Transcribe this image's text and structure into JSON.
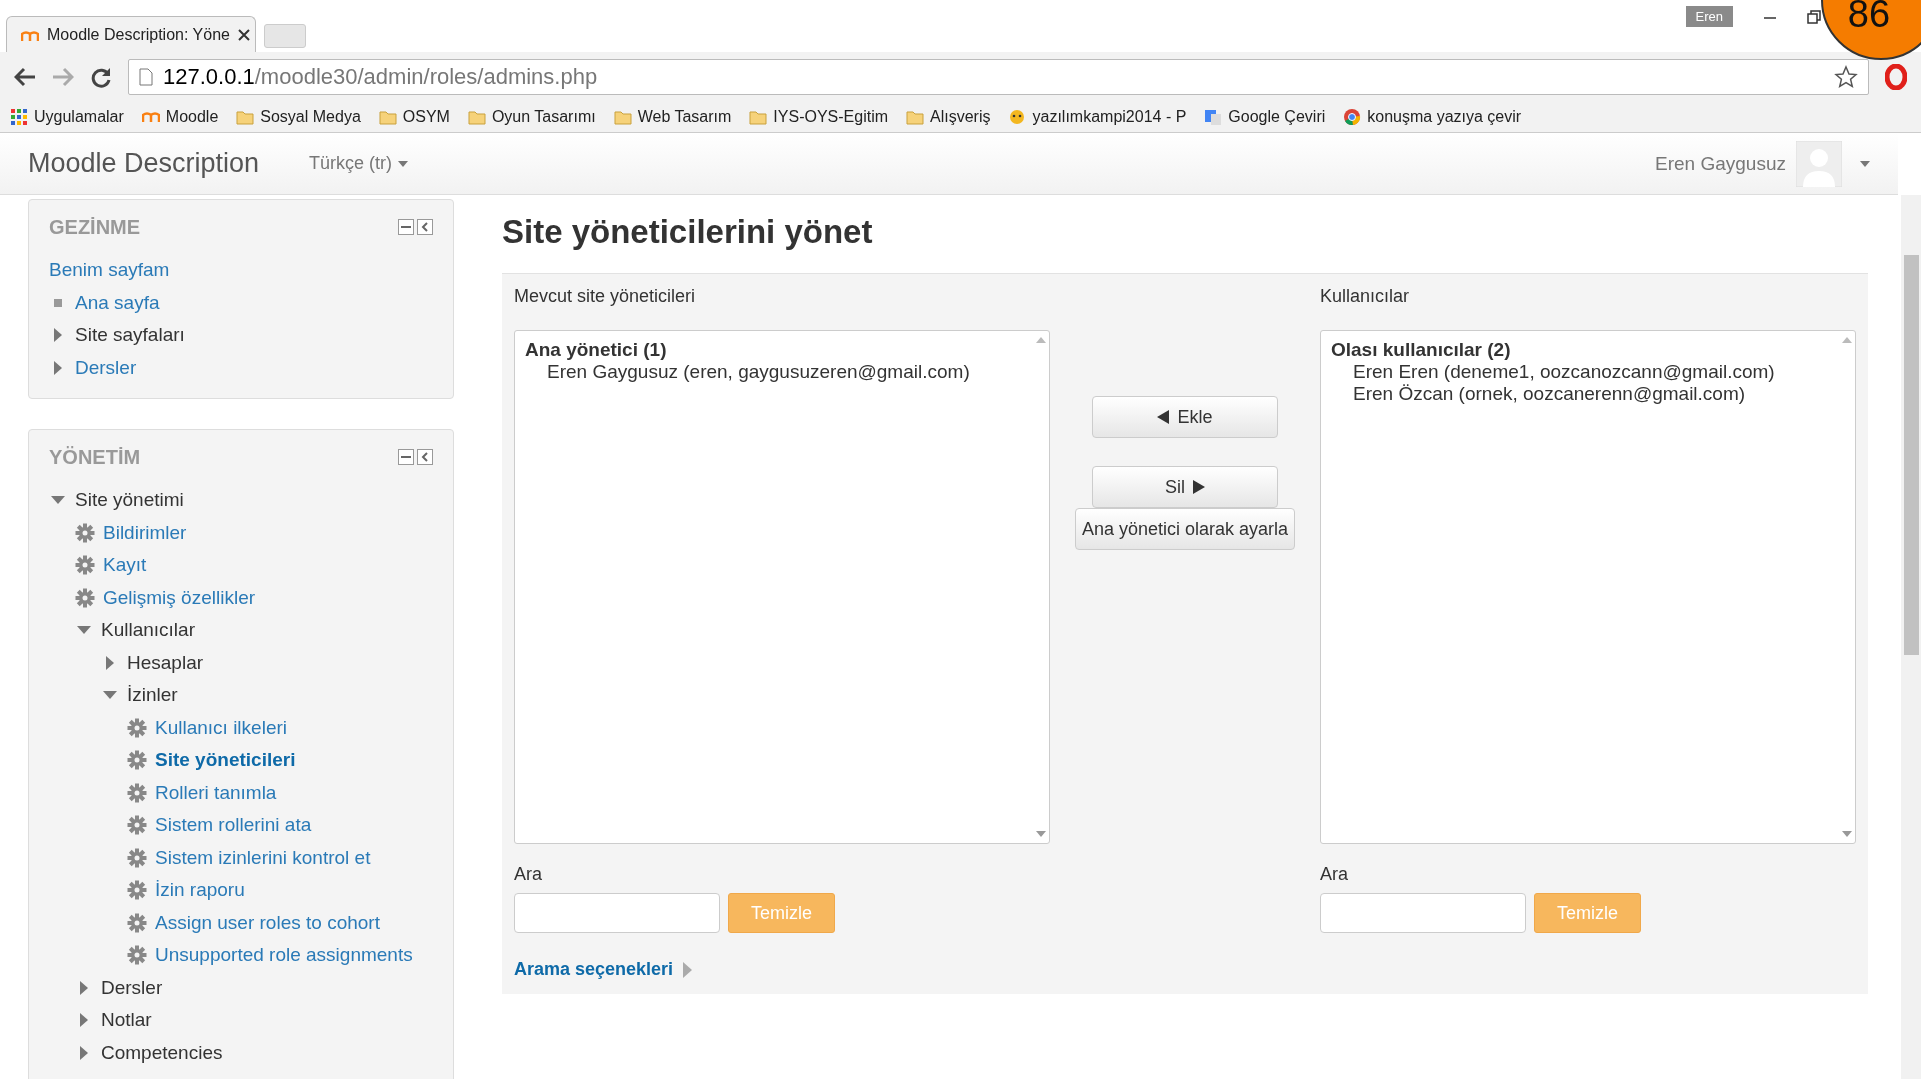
{
  "browser": {
    "tab_title": "Moodle Description: Yöne",
    "profile": "Eren",
    "url_host": "127.0.0.1",
    "url_path": "/moodle30/admin/roles/admins.php",
    "bookmarks": [
      {
        "label": "Uygulamalar",
        "kind": "apps"
      },
      {
        "label": "Moodle",
        "kind": "moodle"
      },
      {
        "label": "Sosyal Medya",
        "kind": "folder"
      },
      {
        "label": "OSYM",
        "kind": "folder"
      },
      {
        "label": "Oyun Tasarımı",
        "kind": "folder"
      },
      {
        "label": "Web Tasarım",
        "kind": "folder"
      },
      {
        "label": "IYS-OYS-Egitim",
        "kind": "folder"
      },
      {
        "label": "Alışveriş",
        "kind": "folder"
      },
      {
        "label": "yazılımkampi2014 - P",
        "kind": "cat"
      },
      {
        "label": "Google Çeviri",
        "kind": "translate"
      },
      {
        "label": "konuşma yazıya çevir",
        "kind": "chrome"
      }
    ]
  },
  "page_badge": "86",
  "navbar": {
    "brand": "Moodle Description",
    "language": "Türkçe (tr)",
    "user": "Eren Gaygusuz"
  },
  "blocks": [
    {
      "title": "GEZİNME",
      "items": [
        {
          "label": "Benim sayfam",
          "kind": "plain",
          "link": true,
          "selected": false
        },
        {
          "label": "Ana sayfa",
          "kind": "bullet",
          "link": true,
          "selected": false
        },
        {
          "label": "Site sayfaları",
          "kind": "branch",
          "expanded": false,
          "link": false,
          "selected": false
        },
        {
          "label": "Dersler",
          "kind": "branch",
          "expanded": false,
          "link": true,
          "selected": false
        }
      ]
    },
    {
      "title": "YÖNETİM",
      "items": [
        {
          "label": "Site yönetimi",
          "kind": "branch",
          "expanded": true,
          "link": false,
          "selected": false,
          "children": [
            {
              "label": "Bildirimler",
              "kind": "gear",
              "link": true,
              "selected": false
            },
            {
              "label": "Kayıt",
              "kind": "gear",
              "link": true,
              "selected": false
            },
            {
              "label": "Gelişmiş özellikler",
              "kind": "gear",
              "link": true,
              "selected": false
            },
            {
              "label": "Kullanıcılar",
              "kind": "branch",
              "expanded": true,
              "link": false,
              "selected": false,
              "children": [
                {
                  "label": "Hesaplar",
                  "kind": "branch",
                  "expanded": false,
                  "link": false,
                  "selected": false
                },
                {
                  "label": "İzinler",
                  "kind": "branch",
                  "expanded": true,
                  "link": false,
                  "selected": false,
                  "children": [
                    {
                      "label": "Kullanıcı ilkeleri",
                      "kind": "gear",
                      "link": true,
                      "selected": false
                    },
                    {
                      "label": "Site yöneticileri",
                      "kind": "gear",
                      "link": true,
                      "selected": true
                    },
                    {
                      "label": "Rolleri tanımla",
                      "kind": "gear",
                      "link": true,
                      "selected": false
                    },
                    {
                      "label": "Sistem rollerini ata",
                      "kind": "gear",
                      "link": true,
                      "selected": false
                    },
                    {
                      "label": "Sistem izinlerini kontrol et",
                      "kind": "gear",
                      "link": true,
                      "selected": false
                    },
                    {
                      "label": "İzin raporu",
                      "kind": "gear",
                      "link": true,
                      "selected": false
                    },
                    {
                      "label": "Assign user roles to cohort",
                      "kind": "gear",
                      "link": true,
                      "selected": false
                    },
                    {
                      "label": "Unsupported role assignments",
                      "kind": "gear",
                      "link": true,
                      "selected": false
                    }
                  ]
                }
              ]
            },
            {
              "label": "Dersler",
              "kind": "branch",
              "expanded": false,
              "link": false,
              "selected": false
            },
            {
              "label": "Notlar",
              "kind": "branch",
              "expanded": false,
              "link": false,
              "selected": false
            },
            {
              "label": "Competencies",
              "kind": "branch",
              "expanded": false,
              "link": false,
              "selected": false
            }
          ]
        }
      ]
    }
  ],
  "heading": "Site yöneticilerini yönet",
  "lists": [
    {
      "label": "Mevcut site yöneticileri",
      "group": "Ana yönetici (1)",
      "options": [
        "Eren Gaygusuz (eren, gaygusuzeren@gmail.com)"
      ],
      "search_label": "Ara",
      "clear_button": "Temizle"
    },
    {
      "label": "Kullanıcılar",
      "group": "Olası kullanıcılar (2)",
      "options": [
        "Eren Eren (deneme1, oozcanozcann@gmail.com)",
        "Eren Özcan (ornek, oozcanerenn@gmail.com)"
      ],
      "search_label": "Ara",
      "clear_button": "Temizle"
    }
  ],
  "actions": [
    {
      "label": "Ekle",
      "kind": "add"
    },
    {
      "label": "Sil",
      "kind": "remove"
    },
    {
      "label": "Ana yönetici olarak ayarla",
      "kind": "plain"
    }
  ],
  "search_options": "Arama seçenekleri"
}
